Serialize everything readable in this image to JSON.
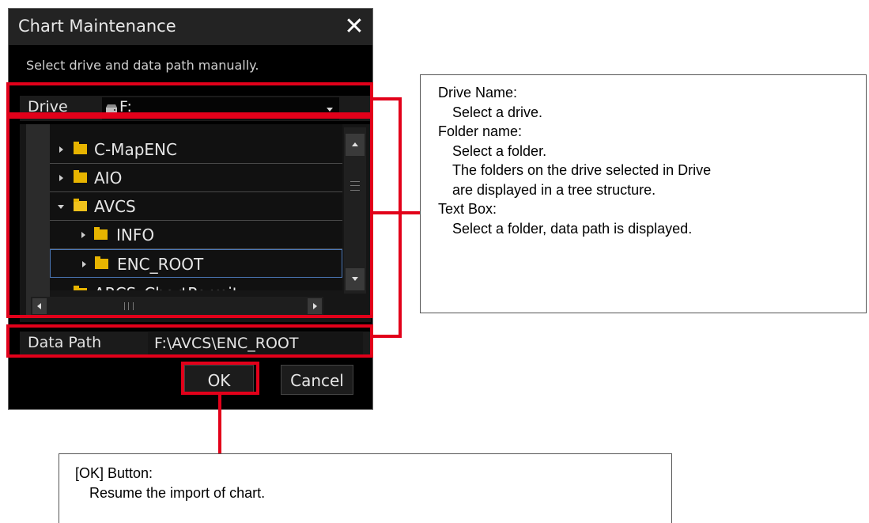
{
  "dialog": {
    "title": "Chart Maintenance",
    "close_glyph": "✕",
    "instruction": "Select drive and data path manually.",
    "drive": {
      "label": "Drive",
      "value": "F:",
      "icon": "drive-icon"
    },
    "tree": {
      "items": [
        {
          "label": "C-MapENC",
          "state": "collapsed",
          "level": 1
        },
        {
          "label": "AIO",
          "state": "collapsed",
          "level": 1
        },
        {
          "label": "AVCS",
          "state": "expanded",
          "level": 1
        },
        {
          "label": "INFO",
          "state": "collapsed",
          "level": 2
        },
        {
          "label": "ENC_ROOT",
          "state": "collapsed",
          "level": 2,
          "selected": true
        },
        {
          "label": "ARCS_ChartPermit",
          "state": "collapsed",
          "level": 1
        }
      ]
    },
    "data_path": {
      "label": "Data Path",
      "value": "F:\\AVCS\\ENC_ROOT"
    },
    "buttons": {
      "ok": "OK",
      "cancel": "Cancel"
    }
  },
  "callouts": {
    "right": {
      "drive_title": "Drive Name:",
      "drive_desc": "Select a drive.",
      "folder_title": "Folder name:",
      "folder_desc1": "Select a folder.",
      "folder_desc2": "The folders on the drive selected in Drive",
      "folder_desc3": "are displayed in a tree structure.",
      "text_title": "Text Box:",
      "text_desc": "Select a folder, data path is displayed."
    },
    "bottom": {
      "title": "[OK] Button:",
      "desc": "Resume the import of chart."
    }
  },
  "colors": {
    "highlight": "#e2001a",
    "folder": "#e7b400",
    "dialog_bg": "#000000",
    "selection_border": "#4b78b8"
  }
}
